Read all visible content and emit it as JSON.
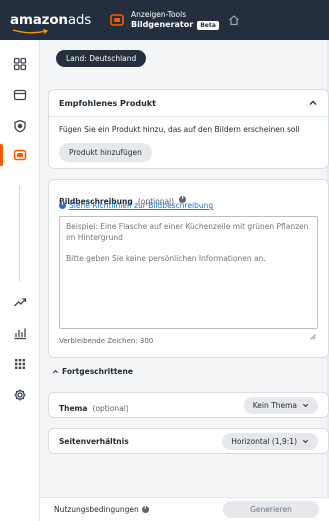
{
  "header": {
    "logo_part1": "amazon",
    "logo_part2": "ads",
    "tool_title": "Anzeigen-Tools",
    "tool_name": "Bildgenerator",
    "beta_badge": "Beta"
  },
  "sidebar": {
    "items": [
      {
        "icon": "dashboard-icon"
      },
      {
        "icon": "campaigns-icon"
      },
      {
        "icon": "shield-icon"
      },
      {
        "icon": "creative-tools-icon",
        "active": true
      },
      {
        "icon": "trend-icon"
      },
      {
        "icon": "reports-icon"
      },
      {
        "icon": "apps-grid-icon"
      },
      {
        "icon": "settings-icon"
      }
    ]
  },
  "country": {
    "label": "Land: Deutschland"
  },
  "product": {
    "title": "Empfohlenes Produkt",
    "description": "Fügen Sie ein Produkt hinzu, das auf den Bildern erscheinen soll",
    "add_button": "Produkt hinzufügen"
  },
  "image_description": {
    "label": "Bildbeschreibung",
    "optional": "(optional)",
    "guidelines_link": "Siehe Richtlinien zur Bildbeschreibung",
    "placeholder": "Beispiel: Eine Flasche auf einer Küchenzeile mit grünen Pflanzen im Hintergrund\n\nBitte geben Sie keine persönlichen Informationen an.",
    "remaining": "Verbleibende Zeichen: 300"
  },
  "advanced": {
    "label": "Fortgeschrittene",
    "theme": {
      "label": "Thema",
      "optional": "(optional)",
      "value": "Kein Thema"
    },
    "aspect": {
      "label": "Seitenverhältnis",
      "value": "Horizontal (1,9:1)"
    }
  },
  "footer": {
    "terms": "Nutzungsbedingungen",
    "generate": "Generieren"
  },
  "colors": {
    "header_bg": "#232f3e",
    "accent": "#ff5a00",
    "link": "#1f6fd1"
  }
}
